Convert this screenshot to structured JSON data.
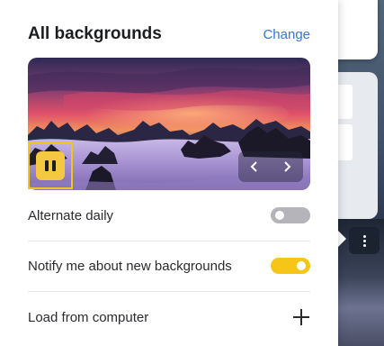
{
  "panel": {
    "title": "All backgrounds",
    "change_label": "Change"
  },
  "preview": {
    "image": "sunset-over-cloud-sea-with-mountain-peaks"
  },
  "controls": {
    "pause_icon": "pause-icon",
    "prev_icon": "chevron-left-icon",
    "next_icon": "chevron-right-icon"
  },
  "settings": {
    "alternate_daily": {
      "label": "Alternate daily",
      "enabled": false
    },
    "notify": {
      "label": "Notify me about new backgrounds",
      "enabled": true
    },
    "load_from_computer": {
      "label": "Load from computer",
      "icon": "plus-icon"
    }
  },
  "background_app": {
    "more_icon": "more-vertical-icon"
  },
  "colors": {
    "accent": "#f5c518",
    "link": "#3876d4",
    "toggle_off": "#b4b4ba",
    "focus_ring": "#f2c51d"
  }
}
